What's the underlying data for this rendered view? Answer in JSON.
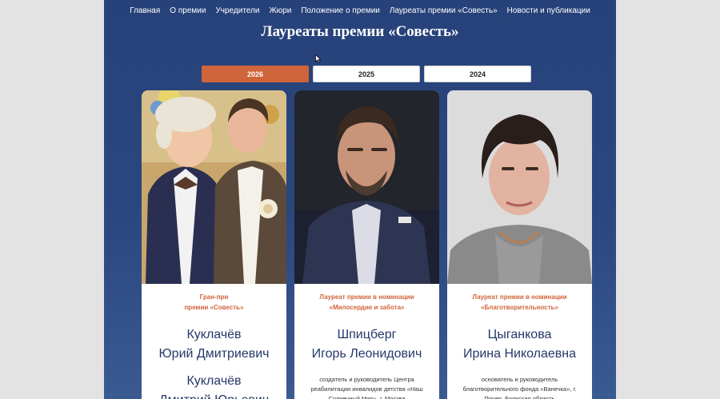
{
  "nav": {
    "items": [
      "Главная",
      "О премии",
      "Учредители",
      "Жюри",
      "Положение о премии",
      "Лауреаты премии «Совесть»",
      "Новости и публикации"
    ]
  },
  "page_title": "Лауреаты премии «Совесть»",
  "years": [
    "2026",
    "2025",
    "2024"
  ],
  "active_year": "2026",
  "laureates": [
    {
      "nomination_line1": "Гран-при",
      "nomination_line2": "премии «Совесть»",
      "persons": [
        {
          "surname": "Куклачёв",
          "given": "Юрий Дмитриевич"
        },
        {
          "surname": "Куклачёв",
          "given": "Дмитрий Юрьевич"
        }
      ],
      "description": ""
    },
    {
      "nomination_line1": "Лауреат премии в номинации",
      "nomination_line2": "«Милосердие и забота»",
      "persons": [
        {
          "surname": "Шпицберг",
          "given": "Игорь Леонидович"
        }
      ],
      "description": "создатель и руководитель Центра реабилитации инвалидов детства «Наш Солнечный Мир», г. Москва"
    },
    {
      "nomination_line1": "Лауреат премии в номинации",
      "nomination_line2": "«Благотворительность»",
      "persons": [
        {
          "surname": "Цыганкова",
          "given": "Ирина Николаевна"
        }
      ],
      "description": "основатель и руководитель благотворительного фонда «Ванечка», г. Почеп, Брянская область"
    }
  ],
  "colors": {
    "accent": "#d0643b",
    "page_bg": "#2b4780",
    "name_text": "#26386a"
  }
}
